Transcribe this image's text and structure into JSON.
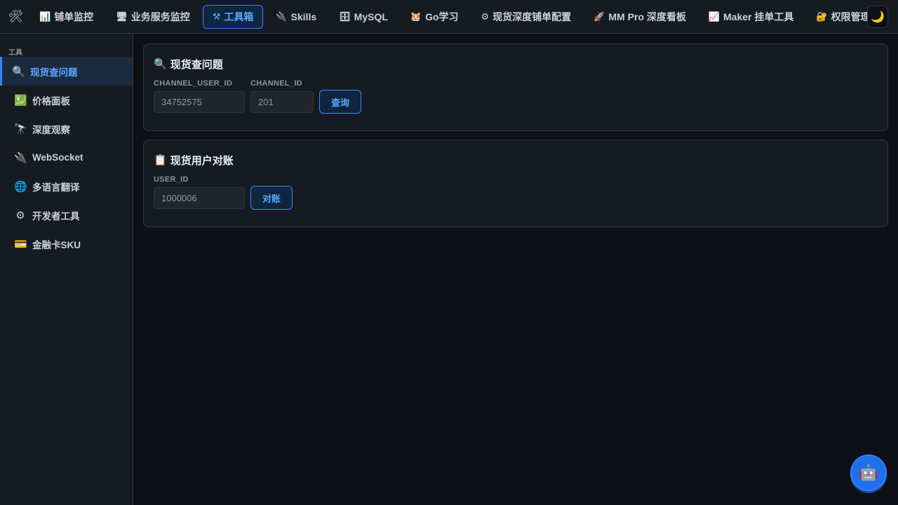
{
  "topnav": {
    "logo_icon": "🛠",
    "items": [
      {
        "icon": "📊",
        "label": "铺单监控",
        "icon_name": "bar-chart-icon"
      },
      {
        "icon": "🖥",
        "label": "业务服务监控",
        "icon_name": "monitor-icon"
      },
      {
        "icon": "⚒",
        "label": "工具箱",
        "icon_name": "tools-icon"
      },
      {
        "icon": "🔌",
        "label": "Skills",
        "icon_name": "plug-icon"
      },
      {
        "icon": "🗄",
        "label": "MySQL",
        "icon_name": "database-icon"
      },
      {
        "icon": "🐹",
        "label": "Go学习",
        "icon_name": "gopher-icon"
      },
      {
        "icon": "⚙",
        "label": "现货深度铺单配置",
        "icon_name": "gear-icon"
      },
      {
        "icon": "🚀",
        "label": "MM Pro 深度看板",
        "icon_name": "rocket-icon"
      },
      {
        "icon": "📈",
        "label": "Maker 挂单工具",
        "icon_name": "trend-up-icon"
      },
      {
        "icon": "🔐",
        "label": "权限管理",
        "icon_name": "lock-key-icon"
      }
    ],
    "active_index": 2,
    "theme_icon": "🌙"
  },
  "sidebar": {
    "section_label": "工具",
    "items": [
      {
        "icon": "🔍",
        "label": "现货查问题"
      },
      {
        "icon": "💹",
        "label": "价格面板"
      },
      {
        "icon": "🔭",
        "label": "深度观察"
      },
      {
        "icon": "🔌",
        "label": "WebSocket"
      },
      {
        "icon": "🌐",
        "label": "多语言翻译"
      },
      {
        "icon": "⚙",
        "label": "开发者工具"
      },
      {
        "icon": "💳",
        "label": "金融卡SKU"
      }
    ],
    "active_index": 0
  },
  "query_card": {
    "icon": "🔍",
    "title": "现货查问题",
    "channel_user_id_label": "CHANNEL_USER_ID",
    "channel_user_id_value": "34752575",
    "channel_id_label": "CHANNEL_ID",
    "channel_id_value": "201",
    "submit_label": "查询"
  },
  "reconcile_card": {
    "icon": "📋",
    "title": "现货用户对账",
    "user_id_label": "USER_ID",
    "user_id_value": "1000006",
    "submit_label": "对账"
  },
  "assistant": {
    "icon": "🤖"
  },
  "colors": {
    "background": "#0d1117",
    "panel": "#161b22",
    "accent": "#3b82f6",
    "accent_text": "#58a6ff"
  }
}
